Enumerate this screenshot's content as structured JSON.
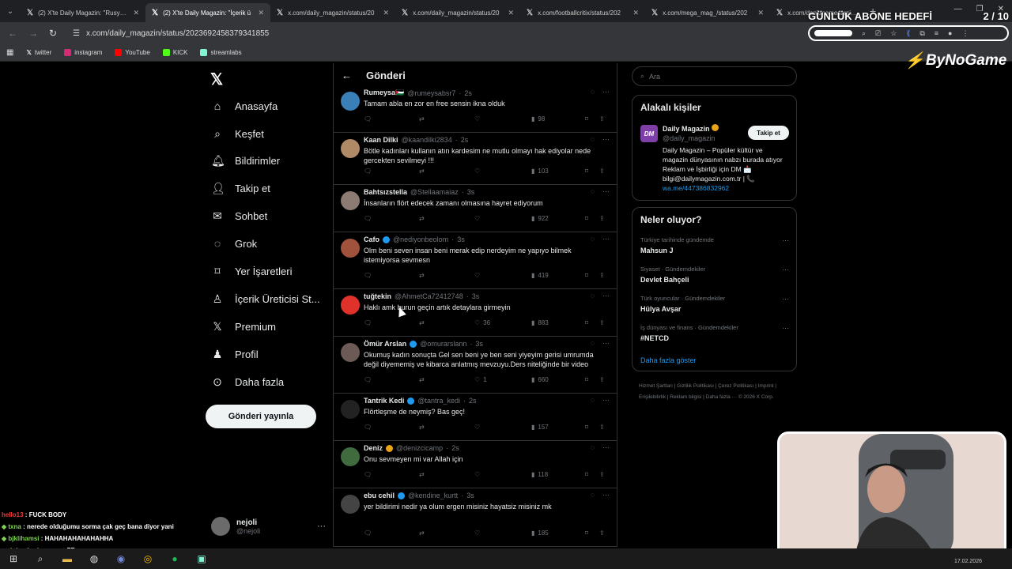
{
  "browser": {
    "tabs": [
      {
        "title": "(2) X'te Daily Magazin: \"Rusya d"
      },
      {
        "title": "(2) X'te Daily Magazin: \"İçerik ü"
      },
      {
        "title": "x.com/daily_magazin/status/20"
      },
      {
        "title": "x.com/daily_magazin/status/20"
      },
      {
        "title": "x.com/footballcritix/status/202"
      },
      {
        "title": "x.com/mega_mag_/status/202"
      },
      {
        "title": "x.com/dankmemesarsiv/status/"
      }
    ],
    "url": "x.com/daily_magazin/status/2023692458379341855",
    "bookmarks": [
      "twitter",
      "instagram",
      "YouTube",
      "KICK",
      "streamlabs"
    ]
  },
  "overlay": {
    "goal_label": "GÜNLÜK ABONE HEDEFİ",
    "goal_count": "2 / 10",
    "brand": "ByNoGame"
  },
  "nav": {
    "items": [
      {
        "label": "Anasayfa",
        "icon": "home-icon"
      },
      {
        "label": "Keşfet",
        "icon": "search-icon"
      },
      {
        "label": "Bildirimler",
        "icon": "bell-icon"
      },
      {
        "label": "Takip et",
        "icon": "person-add-icon"
      },
      {
        "label": "Sohbet",
        "icon": "mail-icon"
      },
      {
        "label": "Grok",
        "icon": "grok-icon"
      },
      {
        "label": "Yer İşaretleri",
        "icon": "bookmark-icon"
      },
      {
        "label": "İçerik Üreticisi St...",
        "icon": "creator-icon"
      },
      {
        "label": "Premium",
        "icon": "x-icon"
      },
      {
        "label": "Profil",
        "icon": "profile-icon"
      },
      {
        "label": "Daha fazla",
        "icon": "more-icon"
      }
    ],
    "post_button": "Gönderi yayınla",
    "user_name": "nejoli",
    "user_handle": "@nejoli"
  },
  "center": {
    "title": "Gönderi",
    "tweets": [
      {
        "name": "Rumeysa🇵🇸",
        "handle": "@rumeysabsr7",
        "time": "2s",
        "text": "Tamam abla en zor en free sensin ikna olduk",
        "likes": "",
        "retweets": "",
        "views": "98",
        "verified": ""
      },
      {
        "name": "Kaan Dilki",
        "handle": "@kaandilki2834",
        "time": "2s",
        "text": "Bötle kadınları kullanın atın kardesim ne mutlu olmayı hak ediyolar nede gercekten sevilmeyi !!!",
        "likes": "",
        "retweets": "",
        "views": "103",
        "verified": ""
      },
      {
        "name": "Bahtsızstella",
        "handle": "@Stellaamaiaz",
        "time": "3s",
        "text": "İnsanların flört edecek zamanı olmasına hayret ediyorum",
        "likes": "",
        "retweets": "",
        "views": "922",
        "verified": ""
      },
      {
        "name": "Cafo",
        "handle": "@nediyonbeolom",
        "time": "3s",
        "text": "Olm beni seven insan beni merak edip nerdeyim ne yapıyo bilmek istemiyorsa sevmesn",
        "likes": "",
        "retweets": "",
        "views": "419",
        "verified": "blue"
      },
      {
        "name": "tuğtekin",
        "handle": "@AhmetCa72412748",
        "time": "3s",
        "text": "Haklı amk burun geçin artık detaylara girmeyin",
        "likes": "36",
        "retweets": "",
        "views": "883",
        "verified": ""
      },
      {
        "name": "Ömür Arslan",
        "handle": "@omurarslann",
        "time": "3s",
        "text": "Okumuş kadın sonuçta Gel sen beni ye ben seni yiyeyim gerisi umrumda değil diyememiş ve kibarca anlatmış mevzuyu.Ders niteliğinde bir video",
        "likes": "1",
        "retweets": "",
        "views": "660",
        "verified": "blue"
      },
      {
        "name": "Tantrik Kedi",
        "handle": "@tantra_kedi",
        "time": "2s",
        "text": "Flörtleşme de neymiş? Bas geç!",
        "likes": "",
        "retweets": "",
        "views": "157",
        "verified": "blue"
      },
      {
        "name": "Deniz",
        "handle": "@denizcicamp",
        "time": "2s",
        "text": "Onu sevmeyen mi var Allah için",
        "likes": "",
        "retweets": "",
        "views": "118",
        "verified": "gold"
      },
      {
        "name": "ebu cehil",
        "handle": "@kendine_kurtt",
        "time": "3s",
        "text": "yer bildirimi nedir ya olum ergen misiniz hayatsiz misiniz mk",
        "likes": "",
        "retweets": "",
        "views": "185",
        "verified": "blue"
      }
    ]
  },
  "right": {
    "search_placeholder": "Ara",
    "related_title": "Alakalı kişiler",
    "related_name": "Daily Magazin",
    "related_handle": "@daily_magazin",
    "related_avatar_text": "DM",
    "follow_label": "Takip et",
    "related_bio": "Daily Magazin – Popüler kültür ve magazin dünyasının nabzı burada atıyor Reklam ve İşbirliği için DM 📩 bilgi@dailymagazin.com.tr | 📞",
    "related_link": "wa.me/447386832962",
    "trends_title": "Neler oluyor?",
    "trends": [
      {
        "category": "Türkiye tarihinde gündemde",
        "name": "Mahsun J"
      },
      {
        "category": "Siyaset · Gündemdekiler",
        "name": "Devlet Bahçeli"
      },
      {
        "category": "Türk oyuncular · Gündemdekiler",
        "name": "Hülya Avşar"
      },
      {
        "category": "İş dünyası ve finans · Gündemdekiler",
        "name": "#NETCD"
      }
    ],
    "show_more": "Daha fazla göster",
    "footer": "Hizmet Şartları | Gizlilik Politikası | Çerez Politikası | Imprint | Erişilebilirlik | Reklam bilgisi | Daha fazla ··· © 2026 X Corp."
  },
  "chat": [
    {
      "user": "hello13",
      "msg": "FUCK BODY",
      "color": "red"
    },
    {
      "user": "txna",
      "msg": "nerede olduğumu sorma çak geç bana diyor yani",
      "color": "green"
    },
    {
      "user": "bjklihamsi",
      "msg": "HAHAHAHAHAHAHHA",
      "color": "green"
    },
    {
      "user": "duhanberkayuner",
      "msg": "FB",
      "color": "green"
    }
  ],
  "taskbar": {
    "date": "17.02.2026"
  },
  "colors": {
    "accent": "#1d9bf0",
    "gold": "#e8a316",
    "bg": "#000000",
    "muted": "#71767b"
  }
}
